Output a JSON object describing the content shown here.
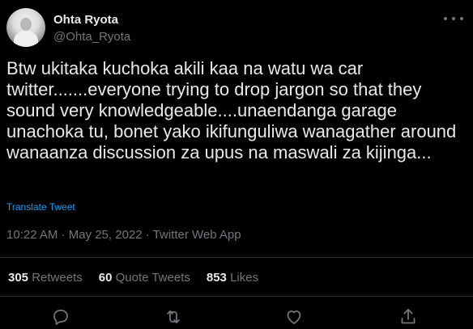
{
  "author": {
    "display_name": "Ohta Ryota",
    "handle": "@Ohta_Ryota"
  },
  "tweet": {
    "text": "Btw ukitaka kuchoka akili kaa na watu wa car twitter.......everyone trying to drop jargon so that they sound very knowledgeable....unaendanga garage unachoka tu, bonet yako ikifunguliwa wanagather around wanaanza discussion za upus na maswali za kijinga...",
    "translate_label": "Translate Tweet",
    "timestamp": "10:22 AM · May 25, 2022 · Twitter Web App"
  },
  "stats": {
    "retweets_count": "305",
    "retweets_label": "Retweets",
    "quotes_count": "60",
    "quotes_label": "Quote Tweets",
    "likes_count": "853",
    "likes_label": "Likes"
  },
  "icons": {
    "more": "more-icon",
    "reply": "reply-icon",
    "retweet": "retweet-icon",
    "like": "like-icon",
    "share": "share-icon"
  },
  "colors": {
    "background": "#000000",
    "text": "#e7e9ea",
    "secondary": "#71767b",
    "link": "#1d9bf0",
    "divider": "#2f3336"
  }
}
